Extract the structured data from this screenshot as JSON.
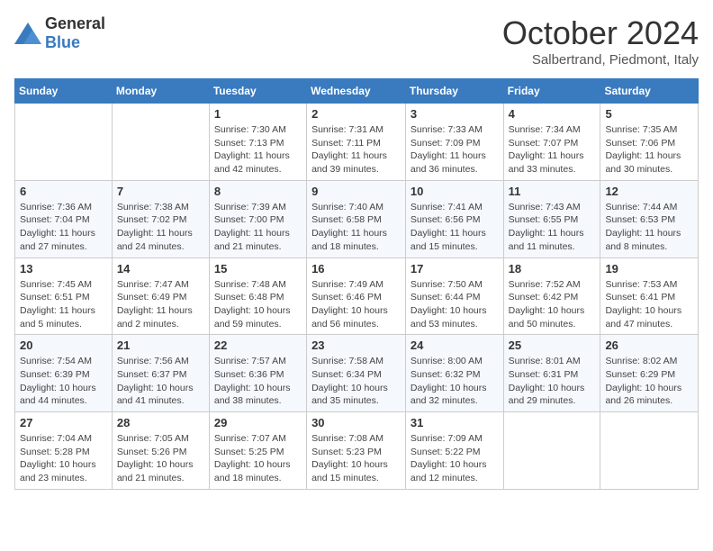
{
  "header": {
    "logo_general": "General",
    "logo_blue": "Blue",
    "month_title": "October 2024",
    "location": "Salbertrand, Piedmont, Italy"
  },
  "weekdays": [
    "Sunday",
    "Monday",
    "Tuesday",
    "Wednesday",
    "Thursday",
    "Friday",
    "Saturday"
  ],
  "weeks": [
    [
      {
        "day": "",
        "sunrise": "",
        "sunset": "",
        "daylight": ""
      },
      {
        "day": "",
        "sunrise": "",
        "sunset": "",
        "daylight": ""
      },
      {
        "day": "1",
        "sunrise": "Sunrise: 7:30 AM",
        "sunset": "Sunset: 7:13 PM",
        "daylight": "Daylight: 11 hours and 42 minutes."
      },
      {
        "day": "2",
        "sunrise": "Sunrise: 7:31 AM",
        "sunset": "Sunset: 7:11 PM",
        "daylight": "Daylight: 11 hours and 39 minutes."
      },
      {
        "day": "3",
        "sunrise": "Sunrise: 7:33 AM",
        "sunset": "Sunset: 7:09 PM",
        "daylight": "Daylight: 11 hours and 36 minutes."
      },
      {
        "day": "4",
        "sunrise": "Sunrise: 7:34 AM",
        "sunset": "Sunset: 7:07 PM",
        "daylight": "Daylight: 11 hours and 33 minutes."
      },
      {
        "day": "5",
        "sunrise": "Sunrise: 7:35 AM",
        "sunset": "Sunset: 7:06 PM",
        "daylight": "Daylight: 11 hours and 30 minutes."
      }
    ],
    [
      {
        "day": "6",
        "sunrise": "Sunrise: 7:36 AM",
        "sunset": "Sunset: 7:04 PM",
        "daylight": "Daylight: 11 hours and 27 minutes."
      },
      {
        "day": "7",
        "sunrise": "Sunrise: 7:38 AM",
        "sunset": "Sunset: 7:02 PM",
        "daylight": "Daylight: 11 hours and 24 minutes."
      },
      {
        "day": "8",
        "sunrise": "Sunrise: 7:39 AM",
        "sunset": "Sunset: 7:00 PM",
        "daylight": "Daylight: 11 hours and 21 minutes."
      },
      {
        "day": "9",
        "sunrise": "Sunrise: 7:40 AM",
        "sunset": "Sunset: 6:58 PM",
        "daylight": "Daylight: 11 hours and 18 minutes."
      },
      {
        "day": "10",
        "sunrise": "Sunrise: 7:41 AM",
        "sunset": "Sunset: 6:56 PM",
        "daylight": "Daylight: 11 hours and 15 minutes."
      },
      {
        "day": "11",
        "sunrise": "Sunrise: 7:43 AM",
        "sunset": "Sunset: 6:55 PM",
        "daylight": "Daylight: 11 hours and 11 minutes."
      },
      {
        "day": "12",
        "sunrise": "Sunrise: 7:44 AM",
        "sunset": "Sunset: 6:53 PM",
        "daylight": "Daylight: 11 hours and 8 minutes."
      }
    ],
    [
      {
        "day": "13",
        "sunrise": "Sunrise: 7:45 AM",
        "sunset": "Sunset: 6:51 PM",
        "daylight": "Daylight: 11 hours and 5 minutes."
      },
      {
        "day": "14",
        "sunrise": "Sunrise: 7:47 AM",
        "sunset": "Sunset: 6:49 PM",
        "daylight": "Daylight: 11 hours and 2 minutes."
      },
      {
        "day": "15",
        "sunrise": "Sunrise: 7:48 AM",
        "sunset": "Sunset: 6:48 PM",
        "daylight": "Daylight: 10 hours and 59 minutes."
      },
      {
        "day": "16",
        "sunrise": "Sunrise: 7:49 AM",
        "sunset": "Sunset: 6:46 PM",
        "daylight": "Daylight: 10 hours and 56 minutes."
      },
      {
        "day": "17",
        "sunrise": "Sunrise: 7:50 AM",
        "sunset": "Sunset: 6:44 PM",
        "daylight": "Daylight: 10 hours and 53 minutes."
      },
      {
        "day": "18",
        "sunrise": "Sunrise: 7:52 AM",
        "sunset": "Sunset: 6:42 PM",
        "daylight": "Daylight: 10 hours and 50 minutes."
      },
      {
        "day": "19",
        "sunrise": "Sunrise: 7:53 AM",
        "sunset": "Sunset: 6:41 PM",
        "daylight": "Daylight: 10 hours and 47 minutes."
      }
    ],
    [
      {
        "day": "20",
        "sunrise": "Sunrise: 7:54 AM",
        "sunset": "Sunset: 6:39 PM",
        "daylight": "Daylight: 10 hours and 44 minutes."
      },
      {
        "day": "21",
        "sunrise": "Sunrise: 7:56 AM",
        "sunset": "Sunset: 6:37 PM",
        "daylight": "Daylight: 10 hours and 41 minutes."
      },
      {
        "day": "22",
        "sunrise": "Sunrise: 7:57 AM",
        "sunset": "Sunset: 6:36 PM",
        "daylight": "Daylight: 10 hours and 38 minutes."
      },
      {
        "day": "23",
        "sunrise": "Sunrise: 7:58 AM",
        "sunset": "Sunset: 6:34 PM",
        "daylight": "Daylight: 10 hours and 35 minutes."
      },
      {
        "day": "24",
        "sunrise": "Sunrise: 8:00 AM",
        "sunset": "Sunset: 6:32 PM",
        "daylight": "Daylight: 10 hours and 32 minutes."
      },
      {
        "day": "25",
        "sunrise": "Sunrise: 8:01 AM",
        "sunset": "Sunset: 6:31 PM",
        "daylight": "Daylight: 10 hours and 29 minutes."
      },
      {
        "day": "26",
        "sunrise": "Sunrise: 8:02 AM",
        "sunset": "Sunset: 6:29 PM",
        "daylight": "Daylight: 10 hours and 26 minutes."
      }
    ],
    [
      {
        "day": "27",
        "sunrise": "Sunrise: 7:04 AM",
        "sunset": "Sunset: 5:28 PM",
        "daylight": "Daylight: 10 hours and 23 minutes."
      },
      {
        "day": "28",
        "sunrise": "Sunrise: 7:05 AM",
        "sunset": "Sunset: 5:26 PM",
        "daylight": "Daylight: 10 hours and 21 minutes."
      },
      {
        "day": "29",
        "sunrise": "Sunrise: 7:07 AM",
        "sunset": "Sunset: 5:25 PM",
        "daylight": "Daylight: 10 hours and 18 minutes."
      },
      {
        "day": "30",
        "sunrise": "Sunrise: 7:08 AM",
        "sunset": "Sunset: 5:23 PM",
        "daylight": "Daylight: 10 hours and 15 minutes."
      },
      {
        "day": "31",
        "sunrise": "Sunrise: 7:09 AM",
        "sunset": "Sunset: 5:22 PM",
        "daylight": "Daylight: 10 hours and 12 minutes."
      },
      {
        "day": "",
        "sunrise": "",
        "sunset": "",
        "daylight": ""
      },
      {
        "day": "",
        "sunrise": "",
        "sunset": "",
        "daylight": ""
      }
    ]
  ]
}
